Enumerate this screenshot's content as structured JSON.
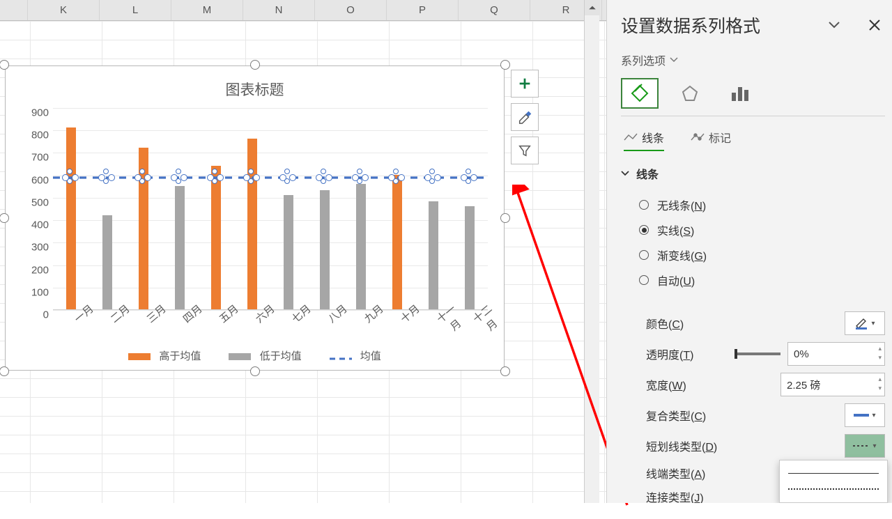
{
  "columns": [
    "K",
    "L",
    "M",
    "N",
    "O",
    "P",
    "Q",
    "R"
  ],
  "chart_data": {
    "type": "bar",
    "title": "图表标题",
    "categories": [
      "一月",
      "二月",
      "三月",
      "四月",
      "五月",
      "六月",
      "七月",
      "八月",
      "九月",
      "十月",
      "十一月",
      "十二月"
    ],
    "series": [
      {
        "name": "高于均值",
        "values": [
          810,
          null,
          720,
          null,
          640,
          760,
          null,
          null,
          null,
          600,
          null,
          null
        ],
        "color": "#ed7d31"
      },
      {
        "name": "低于均值",
        "values": [
          null,
          420,
          null,
          550,
          null,
          null,
          510,
          530,
          560,
          null,
          480,
          460
        ],
        "color": "#a6a6a6"
      },
      {
        "name": "均值",
        "values": [
          590,
          590,
          590,
          590,
          590,
          590,
          590,
          590,
          590,
          590,
          590,
          590
        ],
        "type": "line",
        "color": "#4472c4",
        "dash": true
      }
    ],
    "ylim": [
      0,
      900
    ],
    "ystep": 100,
    "legend": [
      "高于均值",
      "低于均值",
      "均值"
    ]
  },
  "pane": {
    "title": "设置数据系列格式",
    "series_options": "系列选项",
    "tabs": {
      "line": "线条",
      "marker": "标记"
    },
    "section_line": "线条",
    "line_opts": {
      "none": "无线条(N)",
      "solid": "实线(S)",
      "gradient": "渐变线(G)",
      "auto": "自动(U)"
    },
    "props": {
      "color": "颜色(C)",
      "transparency": "透明度(T)",
      "transparency_val": "0%",
      "width": "宽度(W)",
      "width_val": "2.25 磅",
      "compound": "复合类型(C)",
      "dash": "短划线类型(D)",
      "cap": "线端类型(A)",
      "join": "连接类型(J)"
    }
  }
}
